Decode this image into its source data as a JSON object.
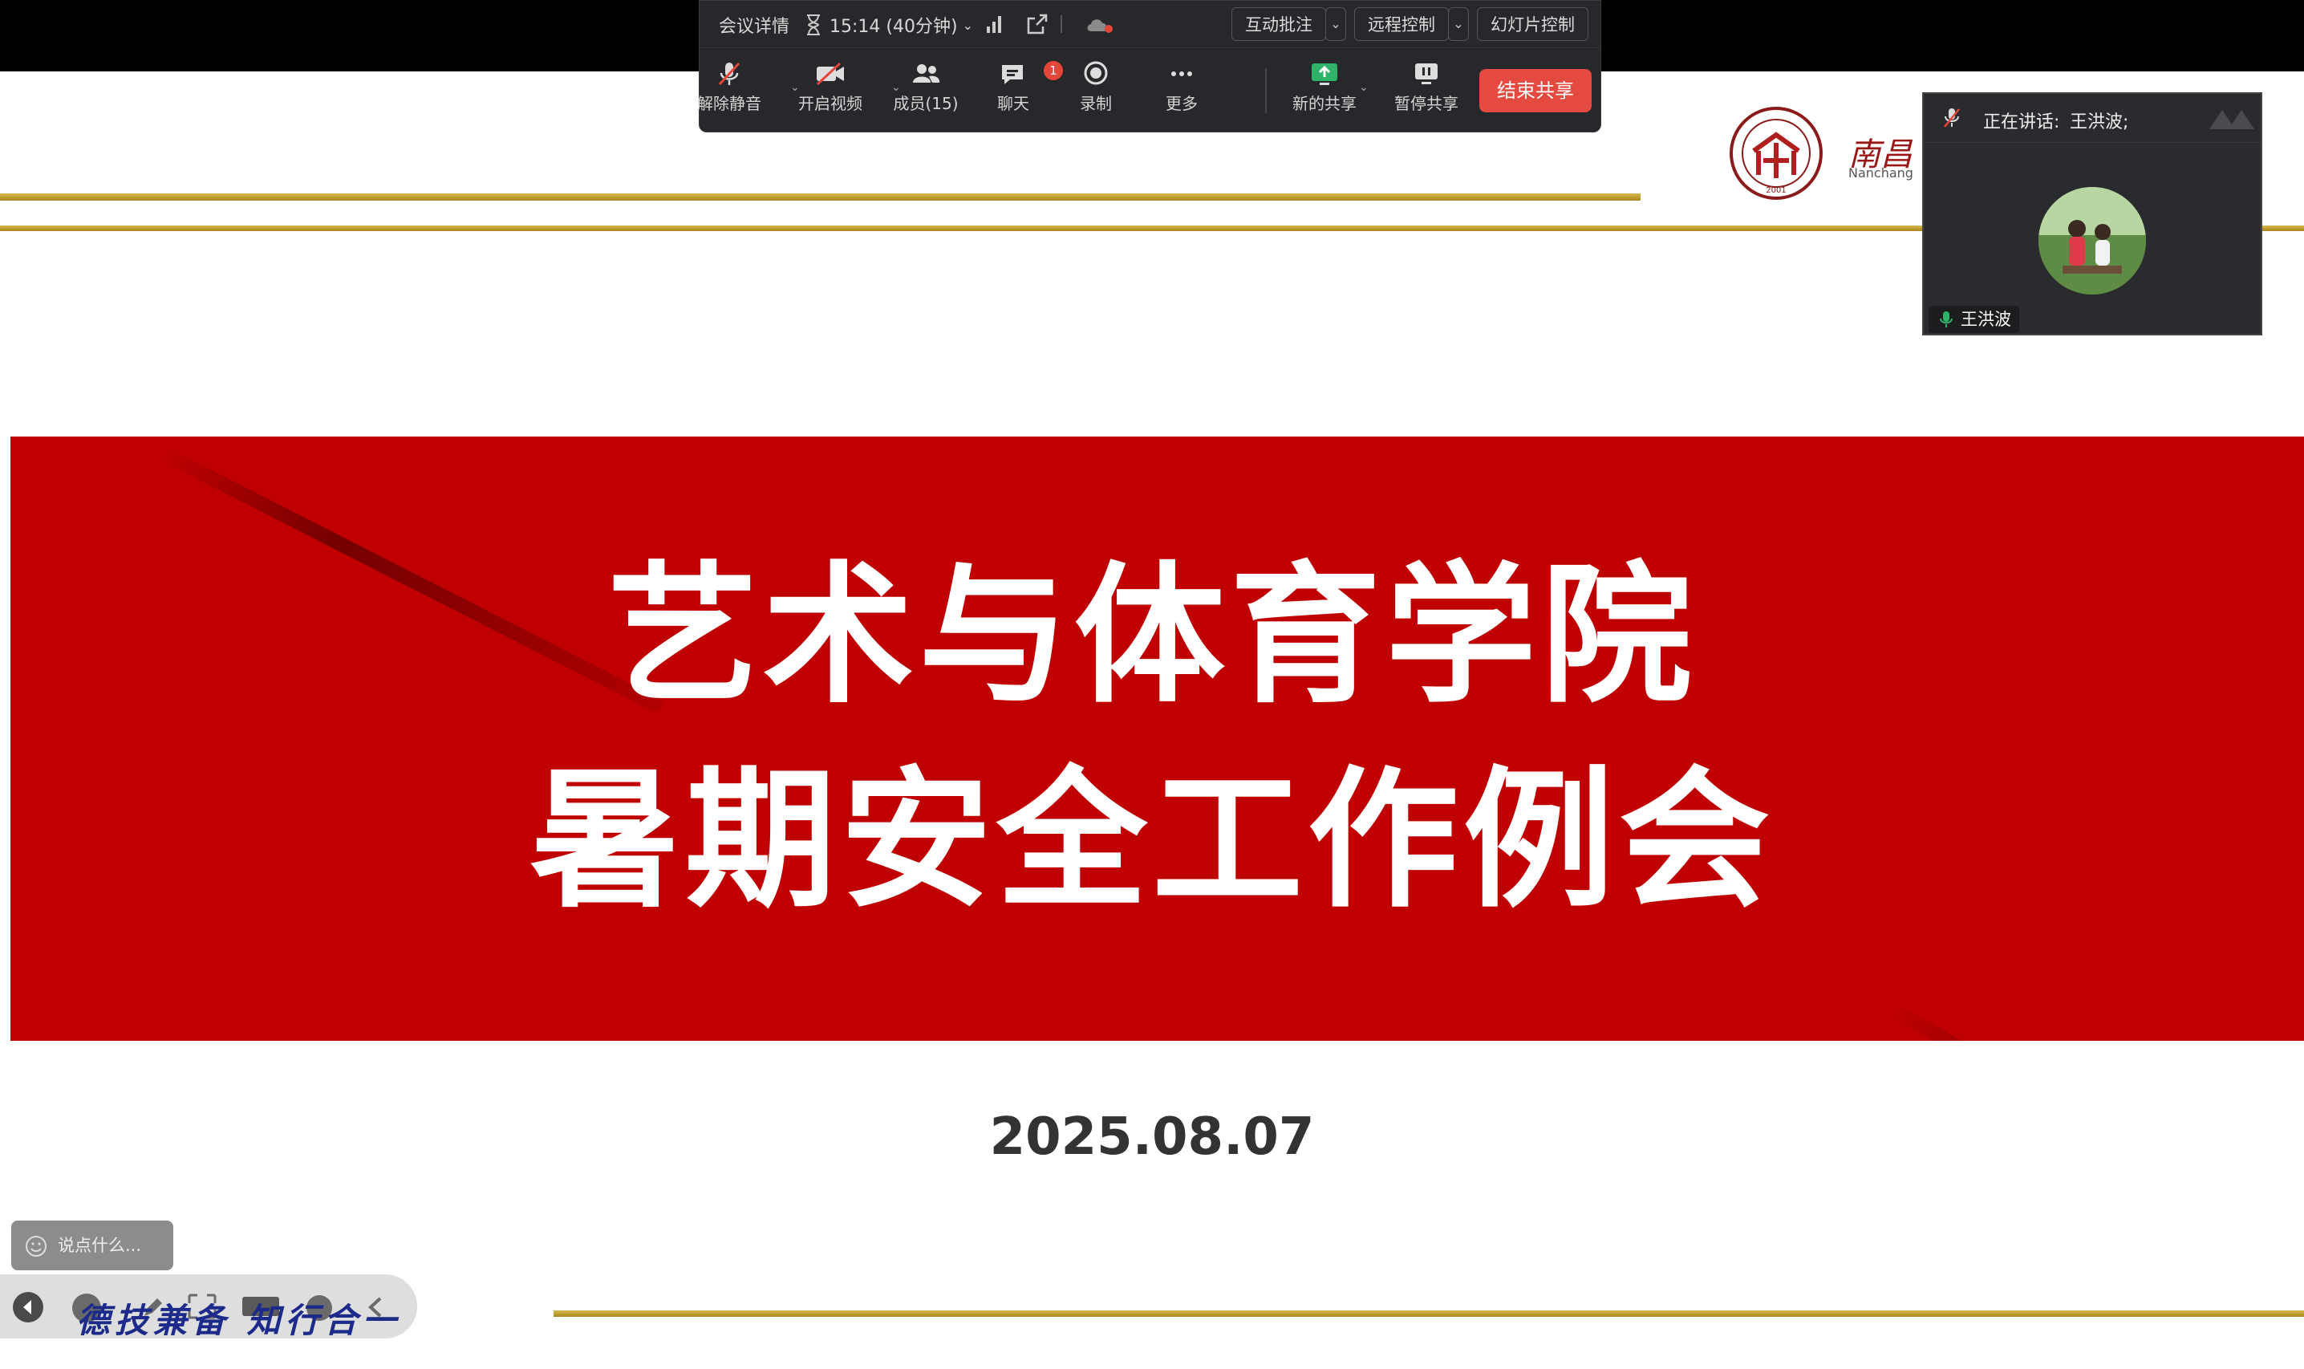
{
  "toolbar": {
    "meeting_details": "会议详情",
    "timer": "15:14 (40分钟)",
    "interactive_annotate": "互动批注",
    "remote_control": "远程控制",
    "slide_control": "幻灯片控制",
    "buttons": [
      {
        "label": "解除静音"
      },
      {
        "label": "开启视频"
      },
      {
        "label": "成员(15)"
      },
      {
        "label": "聊天",
        "badge": "1"
      },
      {
        "label": "录制"
      },
      {
        "label": "更多"
      },
      {
        "label": "新的共享"
      },
      {
        "label": "暂停共享"
      }
    ],
    "end_share": "结束共享"
  },
  "speaker_panel": {
    "speaking_label": "正在讲话:",
    "speaking_name": "王洪波;",
    "participant_name": "王洪波"
  },
  "slide": {
    "logo_name": "南昌",
    "logo_en": "Nanchang",
    "title_line1": "艺术与体育学院",
    "title_line2": "暑期安全工作例会",
    "date": "2025.08.07",
    "motto": "德技兼备 知行合一"
  },
  "chat_input": {
    "placeholder": "说点什么..."
  },
  "colors": {
    "banner_red": "#c00000",
    "gold_line": "#c9a635",
    "toolbar_bg": "#27282b",
    "end_share_red": "#e44a3f"
  }
}
